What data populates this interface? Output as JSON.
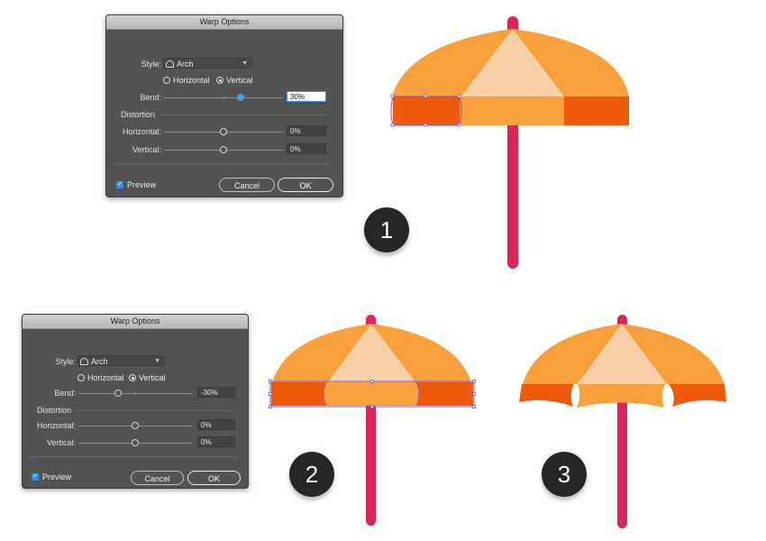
{
  "dialogs": [
    {
      "title": "Warp Options",
      "style_label": "Style:",
      "style_value": "Arch",
      "orientation": {
        "horizontal_label": "Horizontal",
        "vertical_label": "Vertical",
        "selected": "Vertical"
      },
      "bend_label": "Bend:",
      "bend_value": "30%",
      "distortion_label": "Distortion",
      "horizontal_label": "Horizontal:",
      "horizontal_value": "0%",
      "vertical_label": "Vertical:",
      "vertical_value": "0%",
      "preview_label": "Preview",
      "preview_checked": true,
      "cancel_label": "Cancel",
      "ok_label": "OK"
    },
    {
      "title": "Warp Options",
      "style_label": "Style:",
      "style_value": "Arch",
      "orientation": {
        "horizontal_label": "Horizontal",
        "vertical_label": "Vertical",
        "selected": "Vertical"
      },
      "bend_label": "Bend:",
      "bend_value": "-30%",
      "distortion_label": "Distortion",
      "horizontal_label": "Horizontal:",
      "horizontal_value": "0%",
      "vertical_label": "Vertical:",
      "vertical_value": "0%",
      "preview_label": "Preview",
      "preview_checked": true,
      "cancel_label": "Cancel",
      "ok_label": "OK"
    }
  ],
  "steps": [
    "1",
    "2",
    "3"
  ],
  "colors": {
    "umbrella_light_orange": "#f8a13c",
    "umbrella_cream": "#f8cfa6",
    "umbrella_dark_orange": "#ef5a08",
    "umbrella_pole": "#dd2557",
    "selection_outline": "#6f5ad6",
    "slider_blue": "#3aa0f3",
    "dialog_bg": "#535353",
    "badge_bg": "#262626"
  }
}
